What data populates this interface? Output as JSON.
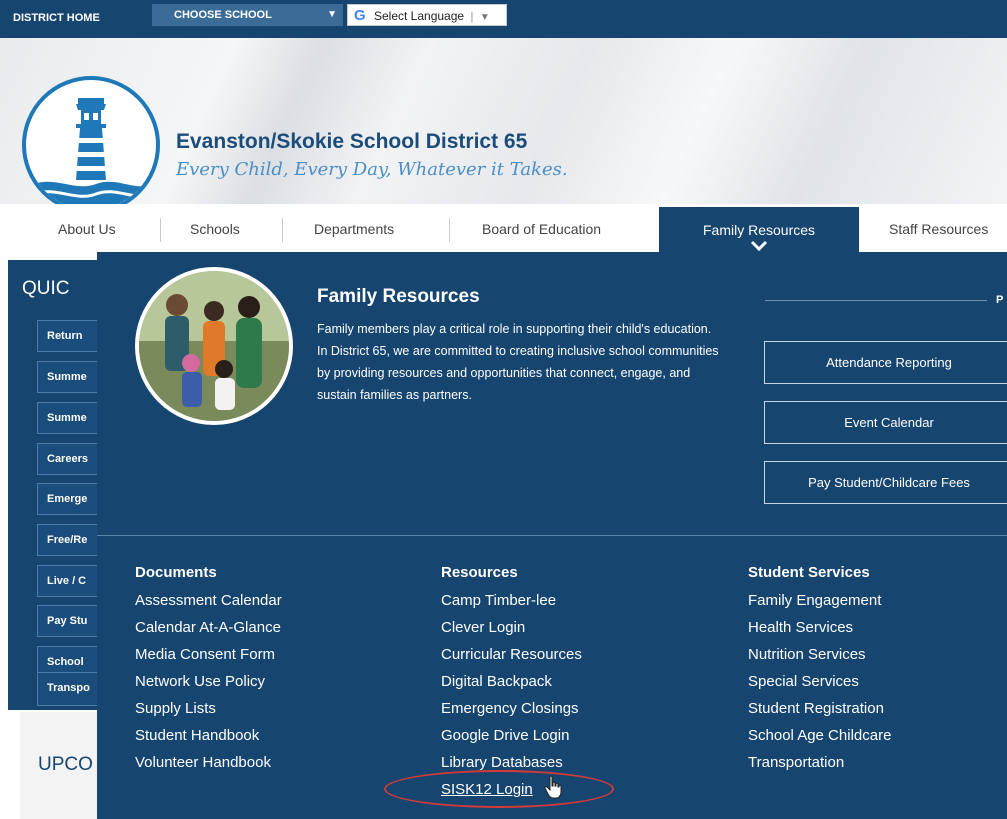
{
  "topbar": {
    "district_home": "DISTRICT HOME",
    "choose_school": "CHOOSE SCHOOL",
    "language": "Select Language",
    "google_mark": "G",
    "separator": "|",
    "dropdown_glyph": "▼"
  },
  "header": {
    "title": "Evanston/Skokie School District 65",
    "tagline": "Every Child, Every Day, Whatever it Takes."
  },
  "nav": {
    "items": [
      "About Us",
      "Schools",
      "Departments",
      "Board of Education",
      "Family Resources",
      "Staff Resources"
    ],
    "active_index": 4
  },
  "sidebar": {
    "title": "QUIC",
    "items": [
      "Return",
      "Summe",
      "Summe",
      "Careers",
      "Emerge",
      "Free/Re",
      "Live / C",
      "Pay Stu",
      "School",
      "Transpo"
    ],
    "upcoming": "UPCO"
  },
  "mega": {
    "title": "Family Resources",
    "description": "Family members play a critical role in supporting their child's education. In District 65, we are committed to creating inclusive school communities by providing resources and opportunities that connect, engage, and sustain families as partners.",
    "popular_label": "P",
    "buttons": [
      "Attendance Reporting",
      "Event Calendar",
      "Pay Student/Childcare Fees"
    ],
    "columns": [
      {
        "heading": "Documents",
        "links": [
          "Assessment Calendar",
          "Calendar At-A-Glance",
          "Media Consent Form",
          "Network Use Policy",
          "Supply Lists",
          "Student Handbook",
          "Volunteer Handbook"
        ]
      },
      {
        "heading": "Resources",
        "links": [
          "Camp Timber-lee",
          "Clever Login",
          "Curricular Resources",
          "Digital Backpack",
          "Emergency Closings",
          "Google Drive Login",
          "Library Databases",
          "SISK12 Login"
        ]
      },
      {
        "heading": "Student Services",
        "links": [
          "Family Engagement",
          "Health Services",
          "Nutrition Services",
          "Special Services",
          "Student Registration",
          "School Age Childcare",
          "Transportation"
        ]
      }
    ]
  },
  "colors": {
    "navy": "#16456f",
    "title_blue": "#1b4c7a",
    "tagline_blue": "#4a8fc6",
    "logo_blue": "#1f79b8",
    "annotation_red": "#d23a3a"
  }
}
